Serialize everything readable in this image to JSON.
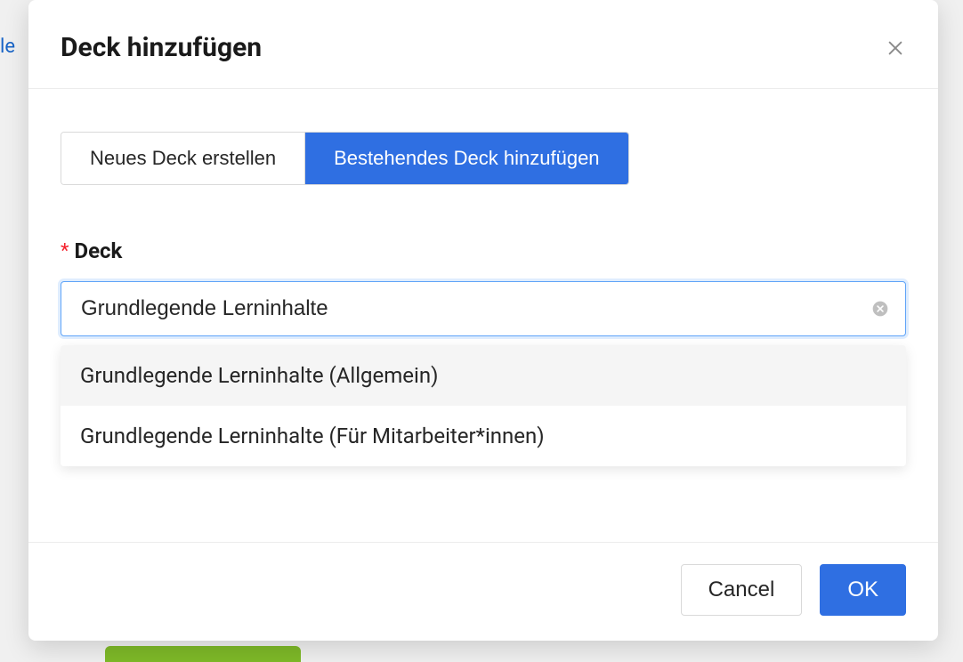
{
  "modal": {
    "title": "Deck hinzufügen",
    "tabs": {
      "create_label": "Neues Deck erstellen",
      "existing_label": "Bestehendes Deck hinzufügen"
    },
    "field": {
      "required_mark": "*",
      "label": "Deck",
      "search_value": "Grundlegende Lerninhalte",
      "options": [
        "Grundlegende Lerninhalte (Allgemein)",
        "Grundlegende Lerninhalte (Für Mitarbeiter*innen)"
      ]
    },
    "footer": {
      "cancel_label": "Cancel",
      "ok_label": "OK"
    }
  },
  "backdrop": {
    "partial_text": "le"
  }
}
